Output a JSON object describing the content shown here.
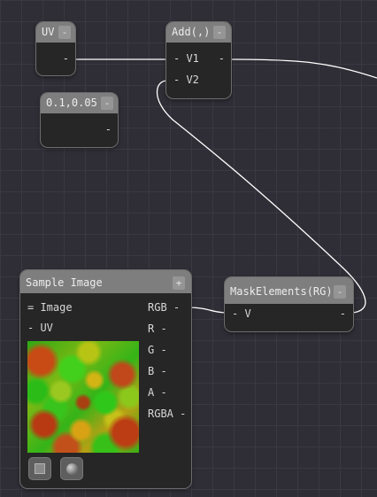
{
  "nodes": {
    "uv": {
      "title": "UV",
      "header_button": "-",
      "output_port": "-"
    },
    "const": {
      "title": "0.1,0.05",
      "header_button": "-",
      "output_port": "-"
    },
    "add": {
      "title": "Add(,)",
      "header_button": "-",
      "inputs": [
        "- V1",
        "- V2"
      ],
      "output_port": "-"
    },
    "sample": {
      "title": "Sample Image",
      "header_button": "+",
      "inputs": [
        "= Image",
        "- UV"
      ],
      "outputs": [
        "RGB -",
        "R -",
        "G -",
        "B -",
        "A -",
        "RGBA -"
      ],
      "preview_buttons": [
        "square-preview-icon",
        "sphere-preview-icon"
      ]
    },
    "mask": {
      "title": "MaskElements(RG)",
      "header_button": "-",
      "input": "- V",
      "output_port": "-"
    }
  },
  "colors": {
    "canvas": "#2f2e36",
    "grid": "#3a3942",
    "node_body": "#262626",
    "node_header": "#7e7e7e",
    "wire": "#ffffff"
  }
}
